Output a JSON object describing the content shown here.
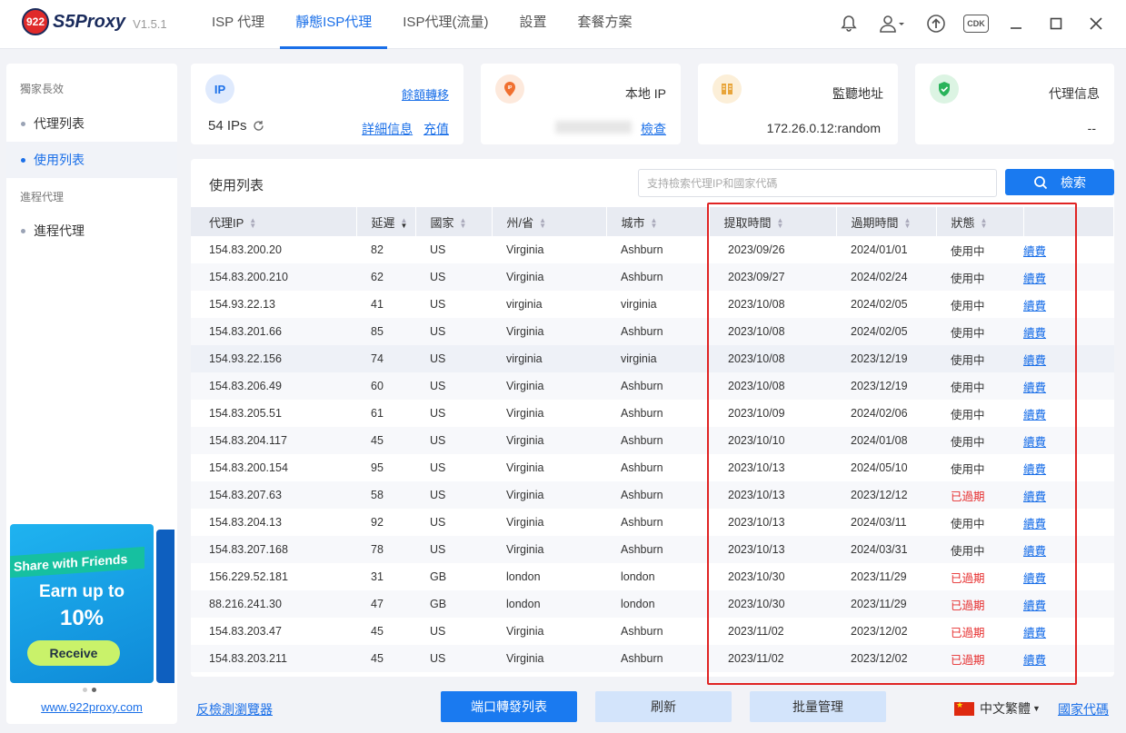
{
  "app": {
    "logo_badge": "922",
    "name": "S5Proxy",
    "version": "V1.5.1"
  },
  "nav": {
    "tabs": [
      {
        "label": "ISP 代理"
      },
      {
        "label": "靜態ISP代理",
        "active": true
      },
      {
        "label": "ISP代理(流量)"
      },
      {
        "label": "設置"
      },
      {
        "label": "套餐方案"
      }
    ],
    "icons": [
      "bell-icon",
      "user-icon",
      "upload-icon",
      "cdk-icon",
      "minimize-icon",
      "maximize-icon",
      "close-icon"
    ],
    "cdk_label": "CDK"
  },
  "sidebar": {
    "section1": "獨家長效",
    "items1": [
      {
        "label": "代理列表"
      },
      {
        "label": "使用列表",
        "active": true
      }
    ],
    "section2": "進程代理",
    "items2": [
      {
        "label": "進程代理"
      }
    ],
    "banner": {
      "headline": "Share with Friends",
      "earn": "Earn up to",
      "percent": "10%",
      "button": "Receive"
    },
    "site_link": "www.922proxy.com"
  },
  "cards": {
    "ip": {
      "icon_text": "IP",
      "transfer_link": "餘額轉移",
      "count": "54 IPs",
      "detail_link": "詳細信息",
      "recharge_link": "充值"
    },
    "local_ip": {
      "icon_text": "IP",
      "title": "本地 IP",
      "check_link": "檢查"
    },
    "listen": {
      "title": "監聽地址",
      "value": "172.26.0.12:random"
    },
    "proxy_info": {
      "title": "代理信息",
      "value": "--"
    }
  },
  "table": {
    "title": "使用列表",
    "search_placeholder": "支持檢索代理IP和國家代碼",
    "search_button": "檢索",
    "columns": [
      "代理IP",
      "延遲",
      "國家",
      "州/省",
      "城市",
      "提取時間",
      "過期時間",
      "狀態",
      ""
    ],
    "rows": [
      {
        "ip": "154.83.200.20",
        "latency": "82",
        "country": "US",
        "state": "Virginia",
        "city": "Ashburn",
        "fetched": "2023/09/26",
        "expires": "2024/01/01",
        "status": "使用中",
        "action": "續費"
      },
      {
        "ip": "154.83.200.210",
        "latency": "62",
        "country": "US",
        "state": "Virginia",
        "city": "Ashburn",
        "fetched": "2023/09/27",
        "expires": "2024/02/24",
        "status": "使用中",
        "action": "續費"
      },
      {
        "ip": "154.93.22.13",
        "latency": "41",
        "country": "US",
        "state": "virginia",
        "city": "virginia",
        "fetched": "2023/10/08",
        "expires": "2024/02/05",
        "status": "使用中",
        "action": "續費"
      },
      {
        "ip": "154.83.201.66",
        "latency": "85",
        "country": "US",
        "state": "Virginia",
        "city": "Ashburn",
        "fetched": "2023/10/08",
        "expires": "2024/02/05",
        "status": "使用中",
        "action": "續費"
      },
      {
        "ip": "154.93.22.156",
        "latency": "74",
        "country": "US",
        "state": "virginia",
        "city": "virginia",
        "fetched": "2023/10/08",
        "expires": "2023/12/19",
        "status": "使用中",
        "action": "續費"
      },
      {
        "ip": "154.83.206.49",
        "latency": "60",
        "country": "US",
        "state": "Virginia",
        "city": "Ashburn",
        "fetched": "2023/10/08",
        "expires": "2023/12/19",
        "status": "使用中",
        "action": "續費"
      },
      {
        "ip": "154.83.205.51",
        "latency": "61",
        "country": "US",
        "state": "Virginia",
        "city": "Ashburn",
        "fetched": "2023/10/09",
        "expires": "2024/02/06",
        "status": "使用中",
        "action": "續費"
      },
      {
        "ip": "154.83.204.117",
        "latency": "45",
        "country": "US",
        "state": "Virginia",
        "city": "Ashburn",
        "fetched": "2023/10/10",
        "expires": "2024/01/08",
        "status": "使用中",
        "action": "續費"
      },
      {
        "ip": "154.83.200.154",
        "latency": "95",
        "country": "US",
        "state": "Virginia",
        "city": "Ashburn",
        "fetched": "2023/10/13",
        "expires": "2024/05/10",
        "status": "使用中",
        "action": "續費"
      },
      {
        "ip": "154.83.207.63",
        "latency": "58",
        "country": "US",
        "state": "Virginia",
        "city": "Ashburn",
        "fetched": "2023/10/13",
        "expires": "2023/12/12",
        "status": "已過期",
        "action": "續費"
      },
      {
        "ip": "154.83.204.13",
        "latency": "92",
        "country": "US",
        "state": "Virginia",
        "city": "Ashburn",
        "fetched": "2023/10/13",
        "expires": "2024/03/11",
        "status": "使用中",
        "action": "續費"
      },
      {
        "ip": "154.83.207.168",
        "latency": "78",
        "country": "US",
        "state": "Virginia",
        "city": "Ashburn",
        "fetched": "2023/10/13",
        "expires": "2024/03/31",
        "status": "使用中",
        "action": "續費"
      },
      {
        "ip": "156.229.52.181",
        "latency": "31",
        "country": "GB",
        "state": "london",
        "city": "london",
        "fetched": "2023/10/30",
        "expires": "2023/11/29",
        "status": "已過期",
        "action": "續費"
      },
      {
        "ip": "88.216.241.30",
        "latency": "47",
        "country": "GB",
        "state": "london",
        "city": "london",
        "fetched": "2023/10/30",
        "expires": "2023/11/29",
        "status": "已過期",
        "action": "續費"
      },
      {
        "ip": "154.83.203.47",
        "latency": "45",
        "country": "US",
        "state": "Virginia",
        "city": "Ashburn",
        "fetched": "2023/11/02",
        "expires": "2023/12/02",
        "status": "已過期",
        "action": "續費"
      },
      {
        "ip": "154.83.203.211",
        "latency": "45",
        "country": "US",
        "state": "Virginia",
        "city": "Ashburn",
        "fetched": "2023/11/02",
        "expires": "2023/12/02",
        "status": "已過期",
        "action": "續費"
      }
    ],
    "expired_label": "已過期",
    "highlight_color": "#e02424"
  },
  "footer": {
    "left_link": "反檢測瀏覽器",
    "buttons": [
      "端口轉發列表",
      "刷新",
      "批量管理"
    ],
    "language": "中文繁體",
    "country_link": "國家代碼"
  },
  "colors": {
    "accent": "#1a7af0",
    "expired": "#e62d2d"
  }
}
